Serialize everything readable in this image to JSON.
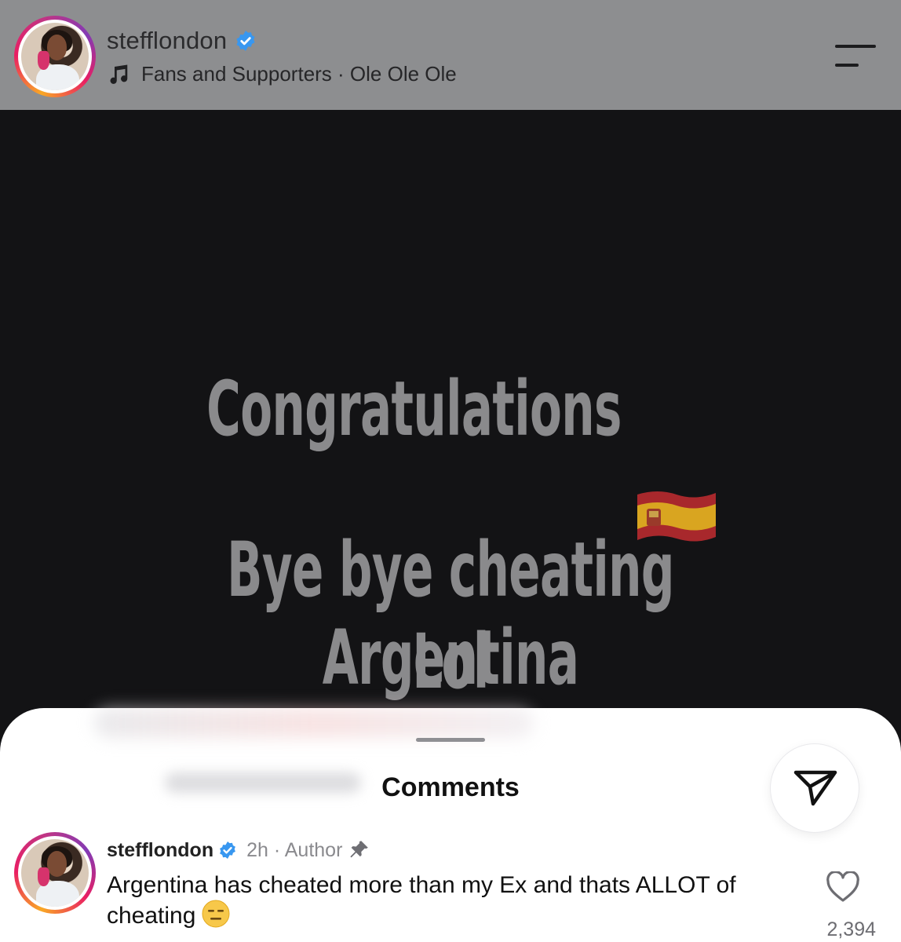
{
  "header": {
    "username": "stefflondon",
    "music": "Fans and Supporters · Ole Ole Ole"
  },
  "post": {
    "line1": "Congratulations",
    "line2": "Bye bye cheating Argentina",
    "line3": "Lol"
  },
  "sheet": {
    "title": "Comments"
  },
  "comment": {
    "username": "stefflondon",
    "meta": "2h · Author",
    "text": "Argentina has cheated more than my Ex and thats ALLOT of cheating",
    "likes": "2,394"
  },
  "icons": {
    "verified": "verified-badge-icon",
    "music": "music-note-icon",
    "menu": "menu-icon",
    "flag": "spain-flag-icon",
    "share": "send-icon",
    "pin": "pin-icon",
    "like": "heart-icon",
    "emoji": "expressionless-face-icon"
  },
  "colors": {
    "header_bg": "#8d8e90",
    "post_bg": "#131315",
    "verified": "#3897f0",
    "post_text": "#8a8a8c"
  }
}
